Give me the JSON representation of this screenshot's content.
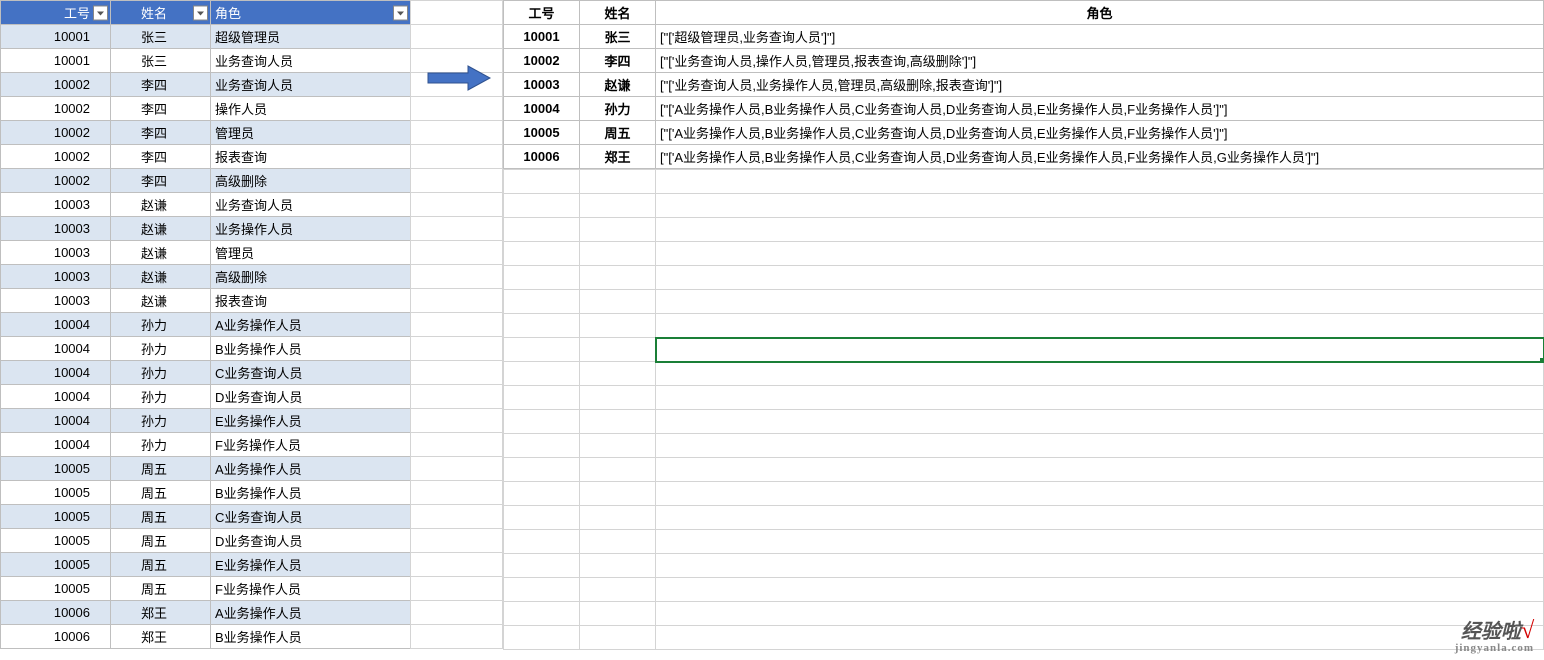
{
  "leftTable": {
    "headers": [
      "工号",
      "姓名",
      "角色"
    ],
    "rows": [
      {
        "id": "10001",
        "name": "张三",
        "role": "超级管理员"
      },
      {
        "id": "10001",
        "name": "张三",
        "role": "业务查询人员"
      },
      {
        "id": "10002",
        "name": "李四",
        "role": "业务查询人员"
      },
      {
        "id": "10002",
        "name": "李四",
        "role": "操作人员"
      },
      {
        "id": "10002",
        "name": "李四",
        "role": "管理员"
      },
      {
        "id": "10002",
        "name": "李四",
        "role": "报表查询"
      },
      {
        "id": "10002",
        "name": "李四",
        "role": "高级删除"
      },
      {
        "id": "10003",
        "name": "赵谦",
        "role": "业务查询人员"
      },
      {
        "id": "10003",
        "name": "赵谦",
        "role": "业务操作人员"
      },
      {
        "id": "10003",
        "name": "赵谦",
        "role": "管理员"
      },
      {
        "id": "10003",
        "name": "赵谦",
        "role": "高级删除"
      },
      {
        "id": "10003",
        "name": "赵谦",
        "role": "报表查询"
      },
      {
        "id": "10004",
        "name": "孙力",
        "role": "A业务操作人员"
      },
      {
        "id": "10004",
        "name": "孙力",
        "role": "B业务操作人员"
      },
      {
        "id": "10004",
        "name": "孙力",
        "role": "C业务查询人员"
      },
      {
        "id": "10004",
        "name": "孙力",
        "role": "D业务查询人员"
      },
      {
        "id": "10004",
        "name": "孙力",
        "role": "E业务操作人员"
      },
      {
        "id": "10004",
        "name": "孙力",
        "role": "F业务操作人员"
      },
      {
        "id": "10005",
        "name": "周五",
        "role": "A业务操作人员"
      },
      {
        "id": "10005",
        "name": "周五",
        "role": "B业务操作人员"
      },
      {
        "id": "10005",
        "name": "周五",
        "role": "C业务查询人员"
      },
      {
        "id": "10005",
        "name": "周五",
        "role": "D业务查询人员"
      },
      {
        "id": "10005",
        "name": "周五",
        "role": "E业务操作人员"
      },
      {
        "id": "10005",
        "name": "周五",
        "role": "F业务操作人员"
      },
      {
        "id": "10006",
        "name": "郑王",
        "role": "A业务操作人员"
      },
      {
        "id": "10006",
        "name": "郑王",
        "role": "B业务操作人员"
      }
    ]
  },
  "rightTable": {
    "headers": [
      "工号",
      "姓名",
      "角色"
    ],
    "rows": [
      {
        "id": "10001",
        "name": "张三",
        "role": "[\"['超级管理员,业务查询人员']\"]"
      },
      {
        "id": "10002",
        "name": "李四",
        "role": "[\"['业务查询人员,操作人员,管理员,报表查询,高级删除']\"]"
      },
      {
        "id": "10003",
        "name": "赵谦",
        "role": "[\"['业务查询人员,业务操作人员,管理员,高级删除,报表查询']\"]"
      },
      {
        "id": "10004",
        "name": "孙力",
        "role": "[\"['A业务操作人员,B业务操作人员,C业务查询人员,D业务查询人员,E业务操作人员,F业务操作人员']\"]"
      },
      {
        "id": "10005",
        "name": "周五",
        "role": "[\"['A业务操作人员,B业务操作人员,C业务查询人员,D业务查询人员,E业务操作人员,F业务操作人员']\"]"
      },
      {
        "id": "10006",
        "name": "郑王",
        "role": "[\"['A业务操作人员,B业务操作人员,C业务查询人员,D业务查询人员,E业务操作人员,F业务操作人员,G业务操作人员']\"]"
      }
    ]
  },
  "watermark": {
    "top": "经验啦",
    "check": "√",
    "bottom": "jingyanla.com"
  }
}
